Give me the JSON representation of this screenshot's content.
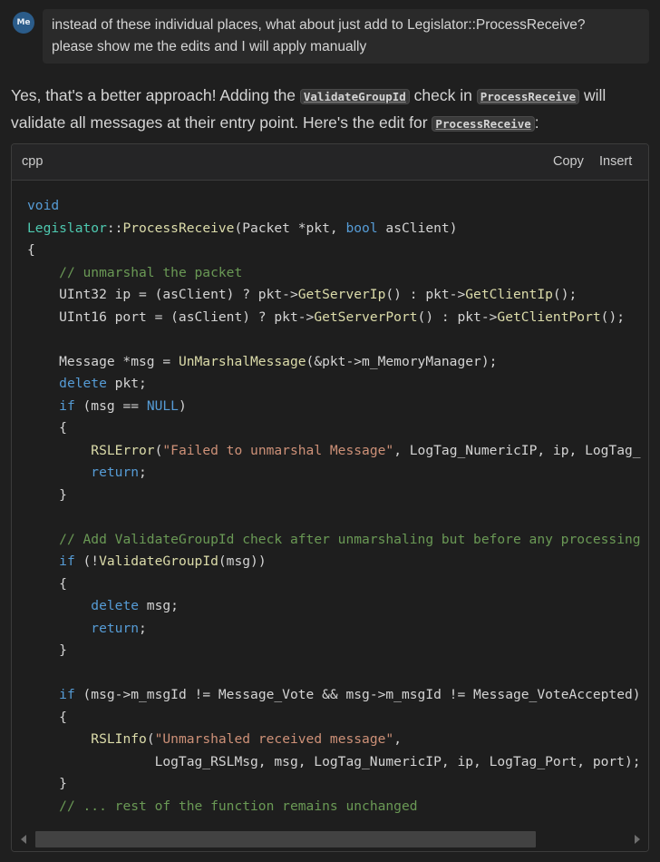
{
  "user_message": {
    "avatar_label": "Me",
    "text": "instead of these individual places, what about just add to Legislator::ProcessReceive?\nplease show me the edits and I will apply manually"
  },
  "reply": {
    "part1": "Yes, that's a better approach! Adding the ",
    "code1": "ValidateGroupId",
    "part2": " check in ",
    "code2": "ProcessReceive",
    "part3": " will validate all messages at their entry point. Here's the edit for ",
    "code3": "ProcessReceive",
    "part4": ":"
  },
  "code_block": {
    "language": "cpp",
    "copy_label": "Copy",
    "insert_label": "Insert",
    "lines": [
      "void",
      "Legislator::ProcessReceive(Packet *pkt, bool asClient)",
      "{",
      "    // unmarshal the packet",
      "    UInt32 ip = (asClient) ? pkt->GetServerIp() : pkt->GetClientIp();",
      "    UInt16 port = (asClient) ? pkt->GetServerPort() : pkt->GetClientPort();",
      "",
      "    Message *msg = UnMarshalMessage(&pkt->m_MemoryManager);",
      "    delete pkt;",
      "    if (msg == NULL)",
      "    {",
      "        RSLError(\"Failed to unmarshal Message\", LogTag_NumericIP, ip, LogTag_",
      "        return;",
      "    }",
      "",
      "    // Add ValidateGroupId check after unmarshaling but before any processing",
      "    if (!ValidateGroupId(msg))",
      "    {",
      "        delete msg;",
      "        return;",
      "    }",
      "",
      "    if (msg->m_msgId != Message_Vote && msg->m_msgId != Message_VoteAccepted)",
      "    {",
      "        RSLInfo(\"Unmarshaled received message\",",
      "                LogTag_RSLMsg, msg, LogTag_NumericIP, ip, LogTag_Port, port);",
      "    }",
      "    // ... rest of the function remains unchanged"
    ]
  },
  "colors": {
    "background": "#1f1f1f",
    "keyword": "#569cd6",
    "function": "#dcdcaa",
    "type": "#4ec9b0",
    "comment": "#6a9955",
    "string": "#ce9178"
  }
}
